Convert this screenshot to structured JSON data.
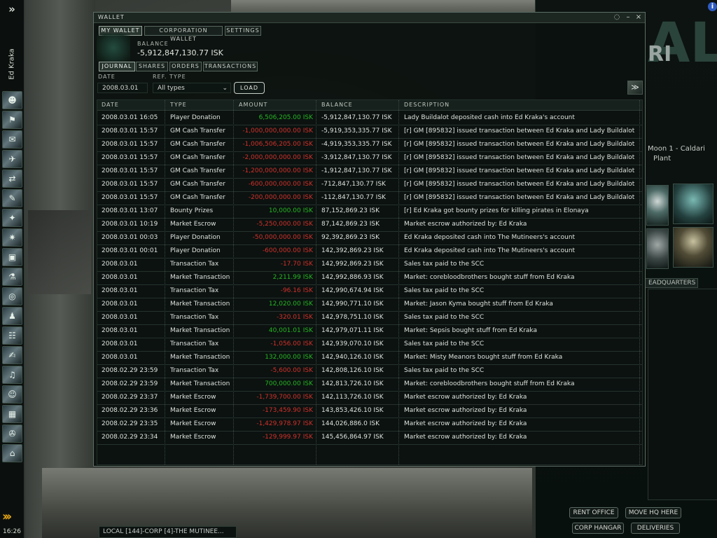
{
  "neocom": {
    "character_name": "Ed Kraka",
    "clock": "16:26",
    "buttons": [
      {
        "icon": "character-sheet-icon"
      },
      {
        "icon": "people-places-icon"
      },
      {
        "icon": "mail-icon"
      },
      {
        "icon": "fleet-icon"
      },
      {
        "icon": "market-icon"
      },
      {
        "icon": "contracts-icon"
      },
      {
        "icon": "map-icon"
      },
      {
        "icon": "star-map-icon"
      },
      {
        "icon": "assets-icon"
      },
      {
        "icon": "science-industry-icon"
      },
      {
        "icon": "help-icon"
      },
      {
        "icon": "journal-icon"
      },
      {
        "icon": "corporation-icon"
      },
      {
        "icon": "notepad-icon"
      },
      {
        "icon": "audio-icon"
      },
      {
        "icon": "portrait-icon"
      },
      {
        "icon": "wallet-icon"
      },
      {
        "icon": "ships-icon"
      },
      {
        "icon": "station-icon"
      }
    ]
  },
  "wallet": {
    "title": "WALLET",
    "top_tabs": [
      "MY WALLET",
      "CORPORATION WALLET",
      "SETTINGS"
    ],
    "balance_label": "BALANCE",
    "balance_value": "-5,912,847,130.77 ISK",
    "sub_tabs": [
      "JOURNAL",
      "SHARES",
      "ORDERS",
      "TRANSACTIONS"
    ],
    "date_label": "DATE",
    "date_value": "2008.03.01",
    "ref_type_label": "REF. TYPE",
    "ref_type_value": "All types",
    "load_label": "LOAD",
    "columns": [
      "DATE",
      "TYPE",
      "AMOUNT",
      "BALANCE",
      "DESCRIPTION"
    ],
    "colors": {
      "positive": "#27b523",
      "negative": "#d2302a"
    },
    "rows": [
      {
        "date": "2008.03.01 16:05",
        "type": "Player Donation",
        "amount": "6,506,205.00",
        "balance": "-5,912,847,130.77 ISK",
        "description": "Lady Buildalot deposited cash into Ed Kraka's account",
        "sign": "positive"
      },
      {
        "date": "2008.03.01 15:57",
        "type": "GM Cash Transfer",
        "amount": "-1,000,000,000.00",
        "balance": "-5,919,353,335.77 ISK",
        "description": "[r] GM [895832] issued transaction between Ed Kraka and Lady Buildalot",
        "sign": "negative"
      },
      {
        "date": "2008.03.01 15:57",
        "type": "GM Cash Transfer",
        "amount": "-1,006,506,205.00",
        "balance": "-4,919,353,335.77 ISK",
        "description": "[r] GM [895832] issued transaction between Ed Kraka and Lady Buildalot",
        "sign": "negative"
      },
      {
        "date": "2008.03.01 15:57",
        "type": "GM Cash Transfer",
        "amount": "-2,000,000,000.00",
        "balance": "-3,912,847,130.77 ISK",
        "description": "[r] GM [895832] issued transaction between Ed Kraka and Lady Buildalot",
        "sign": "negative"
      },
      {
        "date": "2008.03.01 15:57",
        "type": "GM Cash Transfer",
        "amount": "-1,200,000,000.00",
        "balance": "-1,912,847,130.77 ISK",
        "description": "[r] GM [895832] issued transaction between Ed Kraka and Lady Buildalot",
        "sign": "negative"
      },
      {
        "date": "2008.03.01 15:57",
        "type": "GM Cash Transfer",
        "amount": "-600,000,000.00",
        "balance": "-712,847,130.77 ISK",
        "description": "[r] GM [895832] issued transaction between Ed Kraka and Lady Buildalot",
        "sign": "negative"
      },
      {
        "date": "2008.03.01 15:57",
        "type": "GM Cash Transfer",
        "amount": "-200,000,000.00",
        "balance": "-112,847,130.77 ISK",
        "description": "[r] GM [895832] issued transaction between Ed Kraka and Lady Buildalot",
        "sign": "negative"
      },
      {
        "date": "2008.03.01 13:07",
        "type": "Bounty Prizes",
        "amount": "10,000.00",
        "balance": "87,152,869.23 ISK",
        "description": "[r] Ed Kraka got bounty prizes for killing pirates in Elonaya",
        "sign": "positive"
      },
      {
        "date": "2008.03.01 10:19",
        "type": "Market Escrow",
        "amount": "-5,250,000.00",
        "balance": "87,142,869.23 ISK",
        "description": "Market escrow authorized by: Ed Kraka",
        "sign": "negative"
      },
      {
        "date": "2008.03.01 00:03",
        "type": "Player Donation",
        "amount": "-50,000,000.00",
        "balance": "92,392,869.23 ISK",
        "description": "Ed Kraka deposited cash into The Mutineers's account",
        "sign": "negative"
      },
      {
        "date": "2008.03.01 00:01",
        "type": "Player Donation",
        "amount": "-600,000.00",
        "balance": "142,392,869.23 ISK",
        "description": "Ed Kraka deposited cash into The Mutineers's account",
        "sign": "negative"
      },
      {
        "date": "2008.03.01",
        "type": "Transaction Tax",
        "amount": "-17.70",
        "balance": "142,992,869.23 ISK",
        "description": "Sales tax paid to the SCC",
        "sign": "negative"
      },
      {
        "date": "2008.03.01",
        "type": "Market Transaction",
        "amount": "2,211.99",
        "balance": "142,992,886.93 ISK",
        "description": "Market: corebloodbrothers bought stuff from Ed Kraka",
        "sign": "positive"
      },
      {
        "date": "2008.03.01",
        "type": "Transaction Tax",
        "amount": "-96.16",
        "balance": "142,990,674.94 ISK",
        "description": "Sales tax paid to the SCC",
        "sign": "negative"
      },
      {
        "date": "2008.03.01",
        "type": "Market Transaction",
        "amount": "12,020.00",
        "balance": "142,990,771.10 ISK",
        "description": "Market: Jason Kyma bought stuff from Ed Kraka",
        "sign": "positive"
      },
      {
        "date": "2008.03.01",
        "type": "Transaction Tax",
        "amount": "-320.01",
        "balance": "142,978,751.10 ISK",
        "description": "Sales tax paid to the SCC",
        "sign": "negative"
      },
      {
        "date": "2008.03.01",
        "type": "Market Transaction",
        "amount": "40,001.01",
        "balance": "142,979,071.11 ISK",
        "description": "Market: Sepsis bought stuff from Ed Kraka",
        "sign": "positive"
      },
      {
        "date": "2008.03.01",
        "type": "Transaction Tax",
        "amount": "-1,056.00",
        "balance": "142,939,070.10 ISK",
        "description": "Sales tax paid to the SCC",
        "sign": "negative"
      },
      {
        "date": "2008.03.01",
        "type": "Market Transaction",
        "amount": "132,000.00",
        "balance": "142,940,126.10 ISK",
        "description": "Market: Misty Meanors bought stuff from Ed Kraka",
        "sign": "positive"
      },
      {
        "date": "2008.02.29 23:59",
        "type": "Transaction Tax",
        "amount": "-5,600.00",
        "balance": "142,808,126.10 ISK",
        "description": "Sales tax paid to the SCC",
        "sign": "negative"
      },
      {
        "date": "2008.02.29 23:59",
        "type": "Market Transaction",
        "amount": "700,000.00",
        "balance": "142,813,726.10 ISK",
        "description": "Market: corebloodbrothers bought stuff from Ed Kraka",
        "sign": "positive"
      },
      {
        "date": "2008.02.29 23:37",
        "type": "Market Escrow",
        "amount": "-1,739,700.00",
        "balance": "142,113,726.10 ISK",
        "description": "Market escrow authorized by: Ed Kraka",
        "sign": "negative"
      },
      {
        "date": "2008.02.29 23:36",
        "type": "Market Escrow",
        "amount": "-173,459.90",
        "balance": "143,853,426.10 ISK",
        "description": "Market escrow authorized by: Ed Kraka",
        "sign": "negative"
      },
      {
        "date": "2008.02.29 23:35",
        "type": "Market Escrow",
        "amount": "-1,429,978.97",
        "balance": "144,026,886.0 ISK",
        "description": "Market escrow authorized by: Ed Kraka",
        "sign": "negative"
      },
      {
        "date": "2008.02.29 23:34",
        "type": "Market Escrow",
        "amount": "-129,999.97",
        "balance": "145,456,864.97 ISK",
        "description": "Market escrow authorized by: Ed Kraka",
        "sign": "negative"
      }
    ],
    "currency": "ISK"
  },
  "corp_panel": {
    "logo_text": "RI",
    "station_text": "Moon 1 - Caldari",
    "station_text2": "Plant",
    "hq_tab": "EADQUARTERS",
    "buttons": {
      "rent_office": "RENT OFFICE",
      "move_hq": "MOVE HQ HERE",
      "corp_hangar": "CORP HANGAR",
      "deliveries": "DELIVERIES"
    }
  },
  "chat": {
    "tab_label": "LOCAL [144]-CORP [4]-THE MUTINEE..."
  }
}
